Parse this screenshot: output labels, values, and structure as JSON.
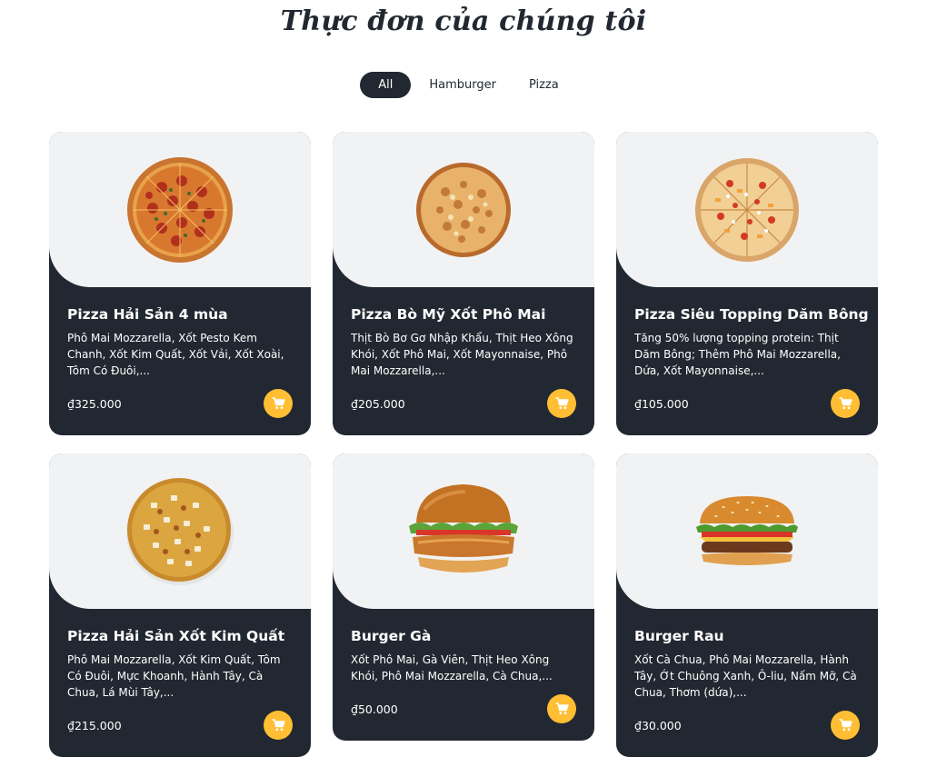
{
  "heading": "Thực đơn của chúng tôi",
  "filters": [
    {
      "label": "All",
      "active": true
    },
    {
      "label": "Hamburger",
      "active": false
    },
    {
      "label": "Pizza",
      "active": false
    }
  ],
  "items": [
    {
      "name": "Pizza Hải Sản 4 mùa",
      "description": "Phô Mai Mozzarella, Xốt Pesto Kem Chanh, Xốt Kim Quất, Xốt Vải, Xốt Xoài, Tôm Có Đuôi,...",
      "price": "₫325.000",
      "image": "pepperoni-pizza-icon"
    },
    {
      "name": "Pizza Bò Mỹ Xốt Phô Mai",
      "description": "Thịt Bò Bơ Gơ Nhập Khẩu, Thịt Heo Xông Khói, Xốt Phô Mai, Xốt Mayonnaise, Phô Mai Mozzarella,...",
      "price": "₫205.000",
      "image": "cheese-pizza-icon"
    },
    {
      "name": "Pizza Siêu Topping Dăm Bông",
      "description": "Tăng 50% lượng topping protein: Thịt Dăm Bông; Thêm Phô Mai Mozzarella, Dứa, Xốt Mayonnaise,...",
      "price": "₫105.000",
      "image": "topping-pizza-icon"
    },
    {
      "name": "Pizza Hải Sản Xốt Kim Quất",
      "description": "Phô Mai Mozzarella, Xốt Kim Quất, Tôm Có Đuôi, Mực Khoanh, Hành Tây, Cà Chua, Lá Mùi Tây,...",
      "price": "₫215.000",
      "image": "onion-pizza-icon"
    },
    {
      "name": "Burger Gà",
      "description": "Xốt Phô Mai, Gà Viên, Thịt Heo Xông Khói, Phô Mai Mozzarella, Cà Chua,...",
      "price": "₫50.000",
      "image": "chicken-burger-icon"
    },
    {
      "name": "Burger Rau",
      "description": "Xốt Cà Chua, Phô Mai Mozzarella, Hành Tây, Ớt Chuông Xanh, Ô-liu, Nấm Mỡ, Cà Chua, Thơm (dứa),...",
      "price": "₫30.000",
      "image": "veggie-burger-icon"
    }
  ],
  "colors": {
    "dark": "#222831",
    "accent": "#ffbe33",
    "image_bg": "#f1f2f3"
  }
}
